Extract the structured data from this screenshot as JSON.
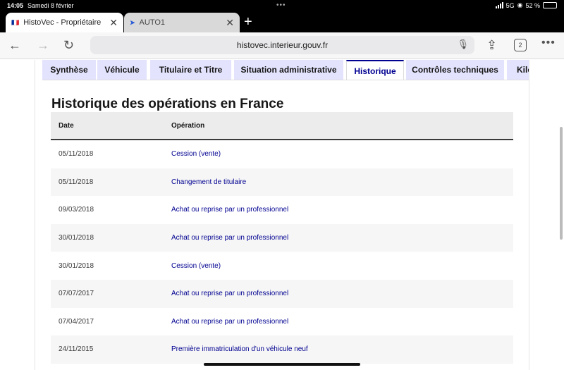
{
  "status": {
    "time": "14:05",
    "date": "Samedi 8 février",
    "network": "5G",
    "battery": "52 %",
    "battery_level": 0.52
  },
  "browser": {
    "tabs": [
      {
        "title": "HistoVec - Propriétaire",
        "favicon": "flag-fr-icon",
        "active": true
      },
      {
        "title": "AUTO1",
        "favicon": "auto1-icon",
        "active": false
      }
    ],
    "url": "histovec.interieur.gouv.fr",
    "tabs_count": "2"
  },
  "nav": {
    "tabs": [
      "Synthèse",
      "Véhicule",
      "Titulaire et Titre",
      "Situation administrative",
      "Historique",
      "Contrôles techniques",
      "Kilo"
    ],
    "active": "Historique"
  },
  "section": {
    "heading": "Historique des opérations en France",
    "columns": {
      "date": "Date",
      "operation": "Opération"
    },
    "rows": [
      {
        "date": "05/11/2018",
        "operation": "Cession (vente)"
      },
      {
        "date": "05/11/2018",
        "operation": "Changement de titulaire"
      },
      {
        "date": "09/03/2018",
        "operation": "Achat ou reprise par un professionnel"
      },
      {
        "date": "30/01/2018",
        "operation": "Achat ou reprise par un professionnel"
      },
      {
        "date": "30/01/2018",
        "operation": "Cession (vente)"
      },
      {
        "date": "07/07/2017",
        "operation": "Achat ou reprise par un professionnel"
      },
      {
        "date": "07/04/2017",
        "operation": "Achat ou reprise par un professionnel"
      },
      {
        "date": "24/11/2015",
        "operation": "Première immatriculation d'un véhicule neuf"
      }
    ]
  },
  "colors": {
    "accent": "#000091",
    "tab_bg": "#e3e3fd"
  }
}
